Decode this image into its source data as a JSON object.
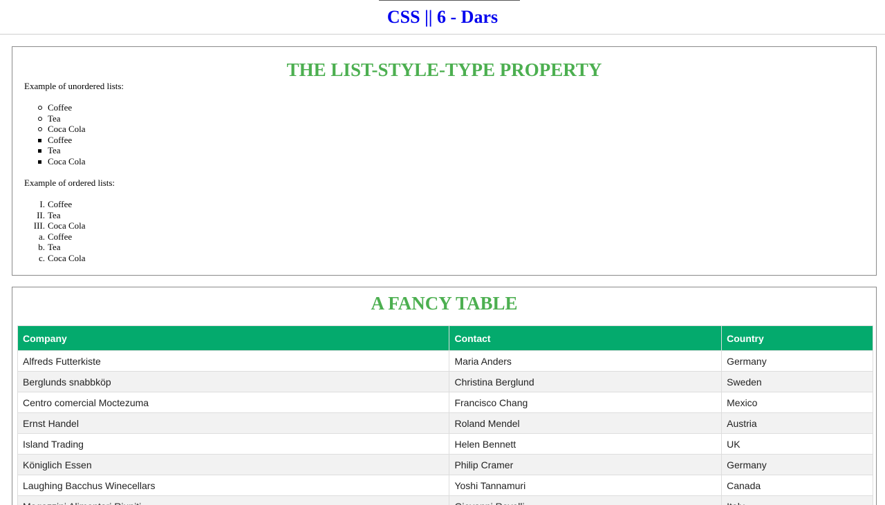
{
  "page": {
    "title": "CSS || 6 - Dars"
  },
  "list_section": {
    "heading": "THE LIST-STYLE-TYPE PROPERTY",
    "unordered_caption": "Example of unordered lists:",
    "ordered_caption": "Example of ordered lists:",
    "unordered_lists": [
      {
        "style": "circle",
        "items": [
          "Coffee",
          "Tea",
          "Coca Cola"
        ]
      },
      {
        "style": "square",
        "items": [
          "Coffee",
          "Tea",
          "Coca Cola"
        ]
      }
    ],
    "ordered_lists": [
      {
        "style": "upper-roman",
        "markers": [
          "I.",
          "II.",
          "III."
        ],
        "items": [
          "Coffee",
          "Tea",
          "Coca Cola"
        ]
      },
      {
        "style": "lower-alpha",
        "markers": [
          "a.",
          "b.",
          "c."
        ],
        "items": [
          "Coffee",
          "Tea",
          "Coca Cola"
        ]
      }
    ]
  },
  "table_section": {
    "heading": "A FANCY TABLE",
    "columns": [
      "Company",
      "Contact",
      "Country"
    ],
    "rows": [
      [
        "Alfreds Futterkiste",
        "Maria Anders",
        "Germany"
      ],
      [
        "Berglunds snabbköp",
        "Christina Berglund",
        "Sweden"
      ],
      [
        "Centro comercial Moctezuma",
        "Francisco Chang",
        "Mexico"
      ],
      [
        "Ernst Handel",
        "Roland Mendel",
        "Austria"
      ],
      [
        "Island Trading",
        "Helen Bennett",
        "UK"
      ],
      [
        "Königlich Essen",
        "Philip Cramer",
        "Germany"
      ],
      [
        "Laughing Bacchus Winecellars",
        "Yoshi Tannamuri",
        "Canada"
      ],
      [
        "Magazzini Alimentari Riuniti",
        "Giovanni Rovelli",
        "Italy"
      ]
    ]
  },
  "colors": {
    "title": "#0000ee",
    "heading": "#4caf50",
    "table_header": "#04aa6d",
    "row_alt": "#f2f2f2"
  }
}
